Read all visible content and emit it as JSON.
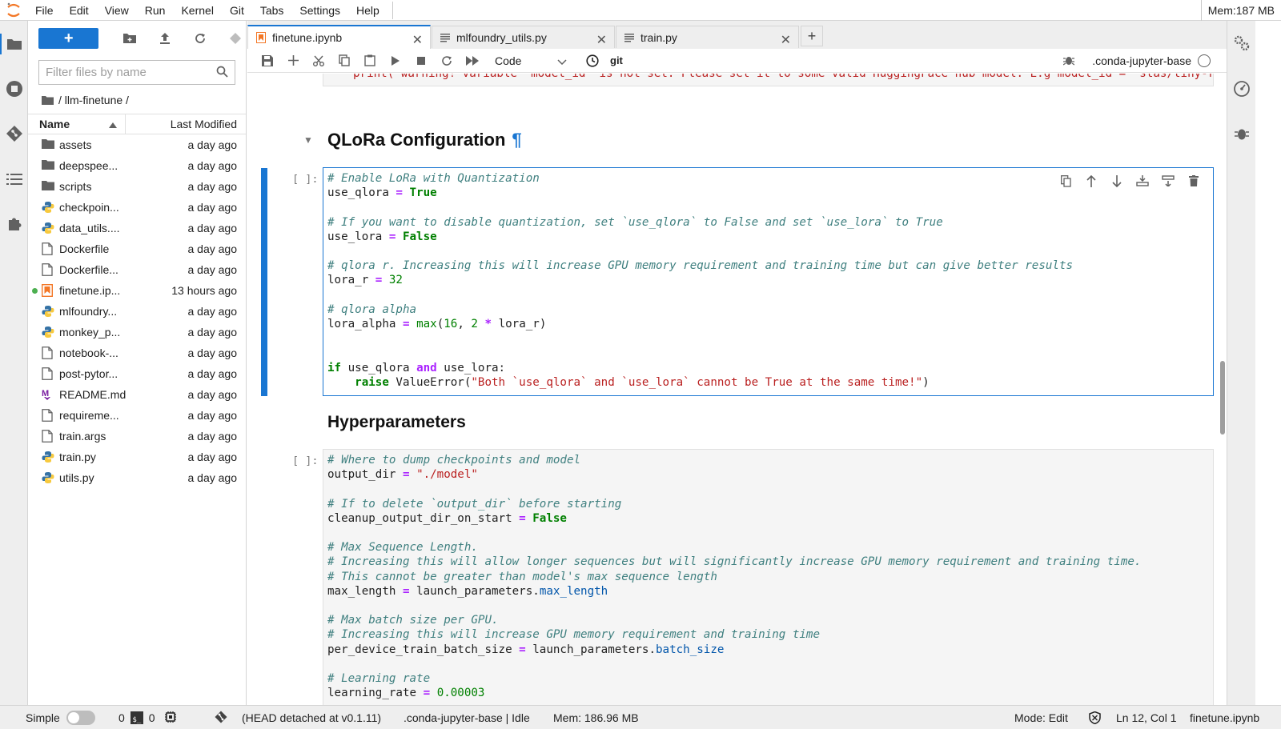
{
  "menubar": {
    "items": [
      "File",
      "Edit",
      "View",
      "Run",
      "Kernel",
      "Git",
      "Tabs",
      "Settings",
      "Help"
    ],
    "memory": "Mem:187 MB"
  },
  "filebrowser": {
    "filter_placeholder": "Filter files by name",
    "breadcrumb": "/ llm-finetune /",
    "col_name": "Name",
    "col_modified": "Last Modified",
    "files": [
      {
        "name": "assets",
        "modified": "a day ago",
        "icon": "folder-icon"
      },
      {
        "name": "deepspee...",
        "modified": "a day ago",
        "icon": "folder-icon"
      },
      {
        "name": "scripts",
        "modified": "a day ago",
        "icon": "folder-icon"
      },
      {
        "name": "checkpoin...",
        "modified": "a day ago",
        "icon": "python-file-icon"
      },
      {
        "name": "data_utils....",
        "modified": "a day ago",
        "icon": "python-file-icon"
      },
      {
        "name": "Dockerfile",
        "modified": "a day ago",
        "icon": "file-icon"
      },
      {
        "name": "Dockerfile...",
        "modified": "a day ago",
        "icon": "file-icon"
      },
      {
        "name": "finetune.ip...",
        "modified": "13 hours ago",
        "icon": "notebook-icon"
      },
      {
        "name": "mlfoundry...",
        "modified": "a day ago",
        "icon": "python-file-icon"
      },
      {
        "name": "monkey_p...",
        "modified": "a day ago",
        "icon": "python-file-icon"
      },
      {
        "name": "notebook-...",
        "modified": "a day ago",
        "icon": "file-icon"
      },
      {
        "name": "post-pytor...",
        "modified": "a day ago",
        "icon": "file-icon"
      },
      {
        "name": "README.md",
        "modified": "a day ago",
        "icon": "markdown-icon"
      },
      {
        "name": "requireme...",
        "modified": "a day ago",
        "icon": "file-icon"
      },
      {
        "name": "train.args",
        "modified": "a day ago",
        "icon": "file-icon"
      },
      {
        "name": "train.py",
        "modified": "a day ago",
        "icon": "python-file-icon"
      },
      {
        "name": "utils.py",
        "modified": "a day ago",
        "icon": "python-file-icon"
      }
    ]
  },
  "tabs": [
    {
      "label": "finetune.ipynb",
      "icon": "notebook-icon",
      "active": true
    },
    {
      "label": "mlfoundry_utils.py",
      "icon": "text-file-icon",
      "active": false
    },
    {
      "label": "train.py",
      "icon": "text-file-icon",
      "active": false
    }
  ],
  "toolbar": {
    "cell_type": "Code",
    "git_label": "git",
    "kernel_name": ".conda-jupyter-base"
  },
  "notebook": {
    "cut_line": "print( warning! variable `model_id` is not set. Please set it to some valid HuggingFace hub model. E.g model_id = \"stas/tiny-ran",
    "heading1": "QLoRa Configuration",
    "heading1_anchor": "¶",
    "heading2": "Hyperparameters",
    "prompt": "[ ]:"
  },
  "statusbar": {
    "mode_label": "Simple",
    "terminals": "0",
    "kernels": "0",
    "git_status": "(HEAD detached at v0.1.11)",
    "kernel_status": ".conda-jupyter-base | Idle",
    "memory": "Mem: 186.96 MB",
    "edit_mode": "Mode: Edit",
    "cursor": "Ln 12, Col 1",
    "filename": "finetune.ipynb"
  },
  "colors": {
    "accent": "#1976d2",
    "running": "#4caf50"
  }
}
